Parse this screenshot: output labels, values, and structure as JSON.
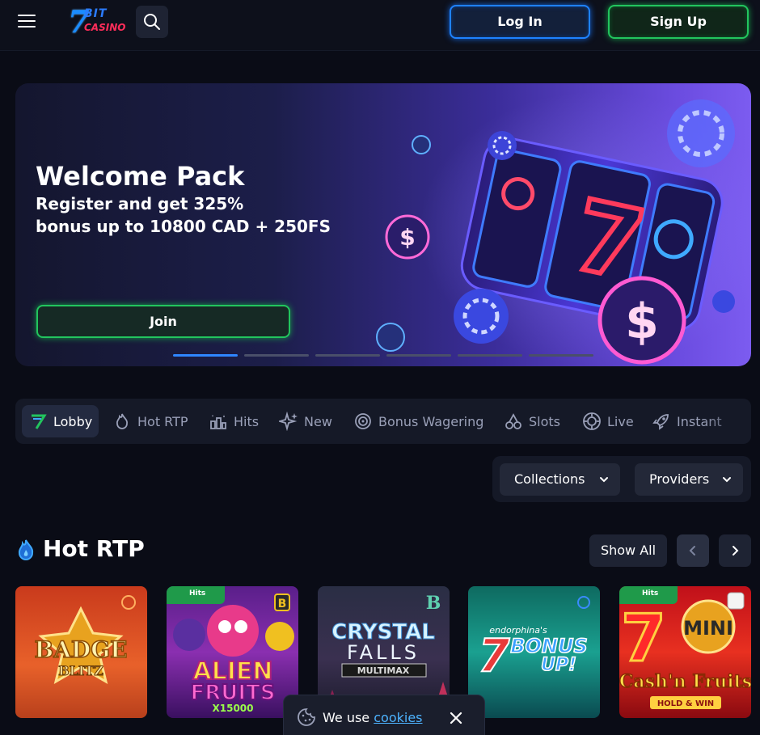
{
  "header": {
    "menu_icon": "hamburger-icon",
    "logo": {
      "digit": "7",
      "word1": "BIT",
      "word2": "CASINO"
    },
    "search_icon": "search-icon",
    "login_label": "Log In",
    "signup_label": "Sign Up"
  },
  "banner": {
    "title": "Welcome Pack",
    "subtitle_line1": "Register and get 325%",
    "subtitle_line2": "bonus up to 10800 CAD + 250FS",
    "cta_label": "Join",
    "slides_count": 6,
    "active_slide": 1
  },
  "categories": [
    {
      "label": "Lobby",
      "icon": "7bit-logo-icon",
      "active": true
    },
    {
      "label": "Hot RTP",
      "icon": "flame-icon"
    },
    {
      "label": "Hits",
      "icon": "chart-hits-icon"
    },
    {
      "label": "New",
      "icon": "sparkles-icon"
    },
    {
      "label": "Bonus Wagering",
      "icon": "target-icon"
    },
    {
      "label": "Slots",
      "icon": "cherries-icon"
    },
    {
      "label": "Live",
      "icon": "chip-icon"
    },
    {
      "label": "Instant",
      "icon": "rocket-icon"
    }
  ],
  "filters": {
    "collections_label": "Collections",
    "providers_label": "Providers"
  },
  "hot_rtp": {
    "title": "Hot RTP",
    "show_all_label": "Show All",
    "games": [
      {
        "title": "BADGE",
        "title2": "BLITZ",
        "tag": ""
      },
      {
        "title": "ALIEN",
        "title2": "FRUITS",
        "sub": "X15000",
        "tag": "Hits",
        "provider_badge": "B"
      },
      {
        "title": "CRYSTAL",
        "title2": "FALLS",
        "sub": "MULTIMAX",
        "tag": "",
        "provider_badge": "B"
      },
      {
        "title": "endorphina's",
        "title2": "BONUS",
        "sub": "UP!",
        "tag": ""
      },
      {
        "title": "MINI",
        "title2": "Cash'n Fruits",
        "sub": "HOLD & WIN",
        "tag": "Hits"
      }
    ]
  },
  "cookie": {
    "text": "We use",
    "link": "cookies"
  },
  "colors": {
    "login_border": "#1e82ff",
    "signup_border": "#22c55e",
    "active_dot": "#2f86ff",
    "link": "#4db3ff"
  }
}
